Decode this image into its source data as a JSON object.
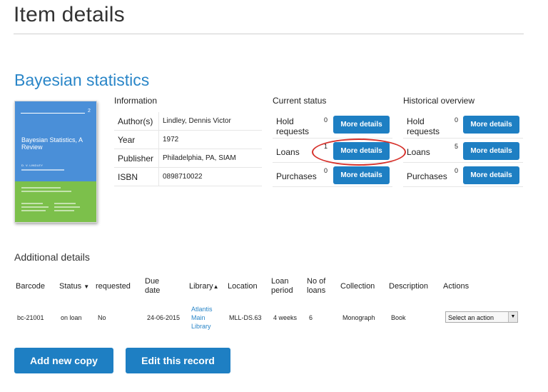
{
  "page_title": "Item details",
  "item": {
    "title": "Bayesian statistics",
    "cover": {
      "number": "2",
      "title": "Bayesian Statistics, A Review",
      "author": "D. V. LINDLEY"
    }
  },
  "information": {
    "label": "Information",
    "rows": [
      {
        "key": "Author(s)",
        "value": "Lindley, Dennis Victor"
      },
      {
        "key": "Year",
        "value": "1972"
      },
      {
        "key": "Publisher",
        "value": "Philadelphia, PA, SIAM"
      },
      {
        "key": "ISBN",
        "value": "0898710022"
      }
    ]
  },
  "current_status": {
    "label": "Current status",
    "rows": [
      {
        "key": "Hold requests",
        "count": "0",
        "button": "More details"
      },
      {
        "key": "Loans",
        "count": "1",
        "button": "More details"
      },
      {
        "key": "Purchases",
        "count": "0",
        "button": "More details"
      }
    ]
  },
  "historical_overview": {
    "label": "Historical overview",
    "rows": [
      {
        "key": "Hold requests",
        "count": "0",
        "button": "More details"
      },
      {
        "key": "Loans",
        "count": "5",
        "button": "More details"
      },
      {
        "key": "Purchases",
        "count": "0",
        "button": "More details"
      }
    ]
  },
  "additional_details": {
    "label": "Additional details",
    "headers": {
      "barcode": "Barcode",
      "status": "Status",
      "requested": "requested",
      "due_date": "Due date",
      "library": "Library",
      "location": "Location",
      "loan_period": "Loan period",
      "no_of_loans": "No of loans",
      "collection": "Collection",
      "description": "Description",
      "actions": "Actions"
    },
    "row": {
      "barcode": "bc-21001",
      "status": "on loan",
      "requested": "No",
      "due_date": "24-06-2015",
      "library": "Atlantis Main Library",
      "location": "MLL-DS.63",
      "loan_period": "4 weeks",
      "no_of_loans": "6",
      "collection": "Monograph",
      "description": "Book",
      "action_select": "Select an action"
    }
  },
  "buttons": {
    "add_copy": "Add new copy",
    "edit_record": "Edit this record"
  },
  "colors": {
    "accent": "#1e7fc3",
    "link": "#2a86c8",
    "highlight": "#d6312b"
  }
}
